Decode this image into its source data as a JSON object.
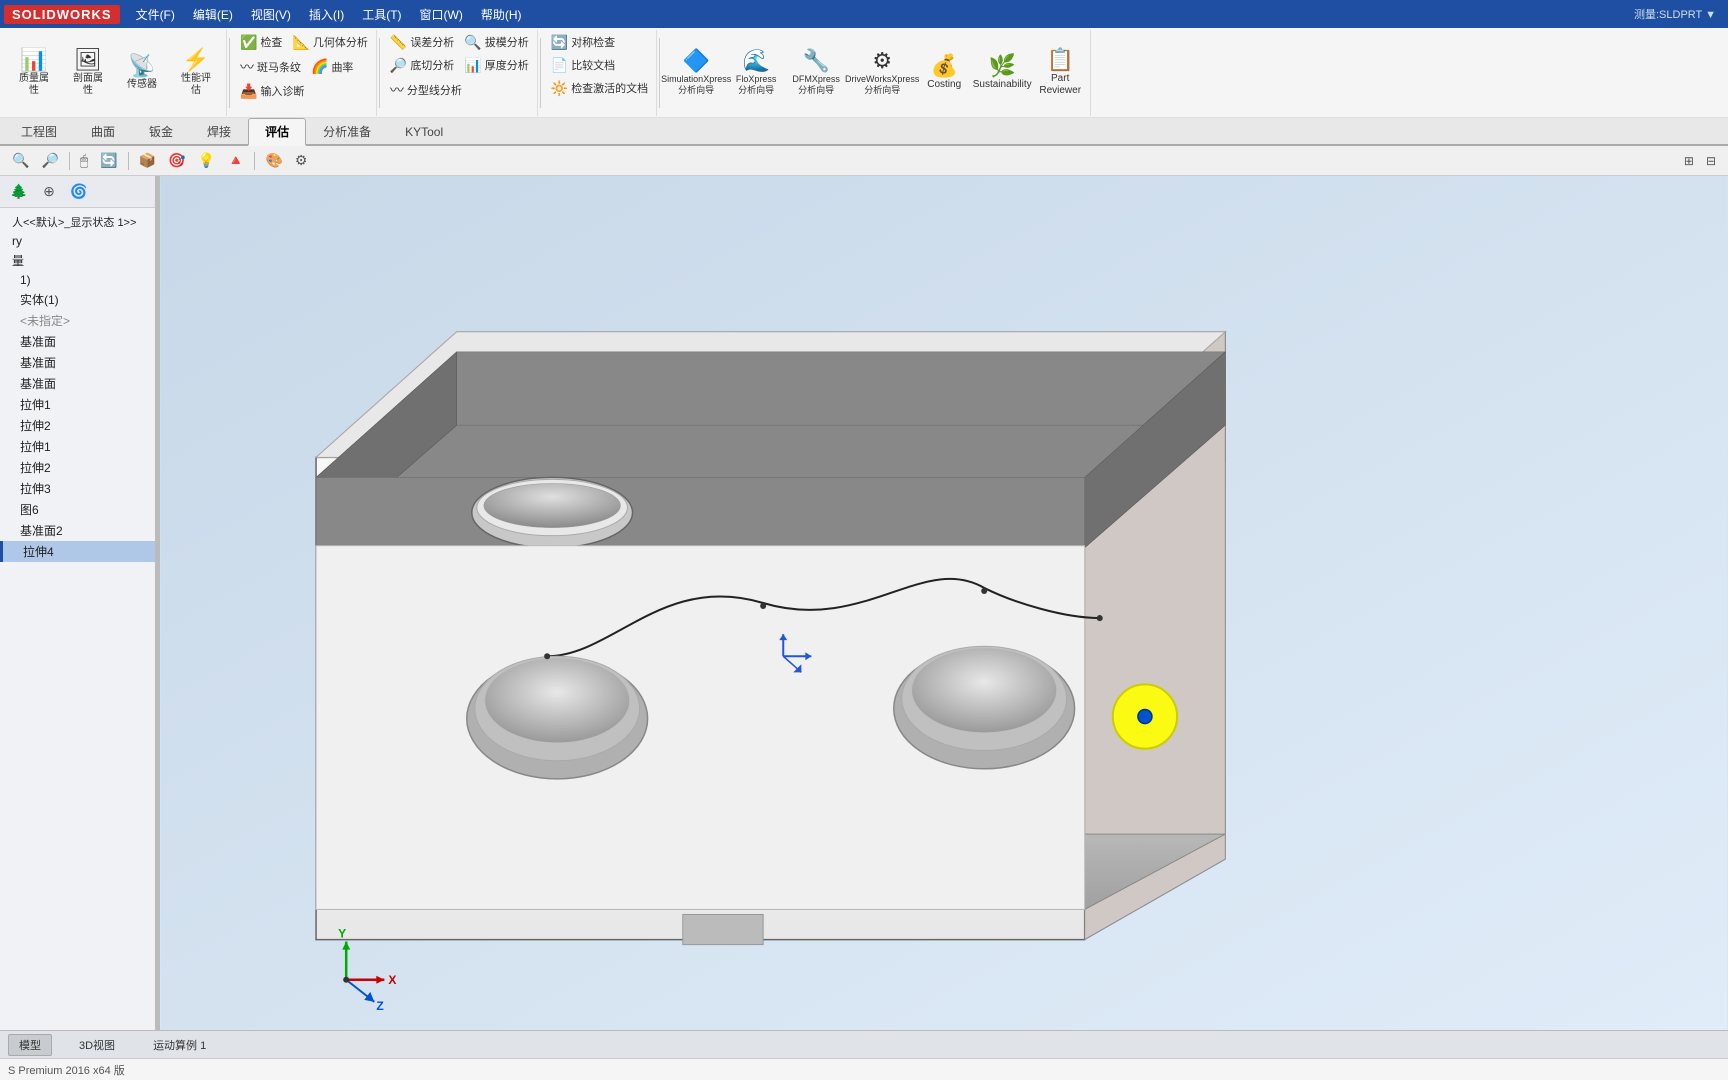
{
  "app": {
    "logo": "SOLIDWORKS",
    "title_bar_info": "测量:SLDPRT ▼",
    "menus": [
      "文件(F)",
      "编辑(E)",
      "视图(V)",
      "插入(I)",
      "工具(T)",
      "窗口(W)",
      "帮助(H)"
    ]
  },
  "toolbar": {
    "pin_icon": "📌",
    "groups": [
      {
        "name": "quality-group",
        "buttons": [
          {
            "id": "quality-check",
            "icon": "📊",
            "label": "质量属\n性"
          },
          {
            "id": "section-view",
            "icon": "📋",
            "label": "剖面属\n性"
          },
          {
            "id": "sensor",
            "icon": "📡",
            "label": "传感器"
          },
          {
            "id": "performance",
            "icon": "⚡",
            "label": "性能评\n估"
          }
        ]
      },
      {
        "name": "check-group",
        "buttons": [
          {
            "id": "check",
            "icon": "✅",
            "label": "检查"
          },
          {
            "id": "geometry-check",
            "icon": "📐",
            "label": "几何体分析"
          },
          {
            "id": "zebra-lines",
            "icon": "🦓",
            "label": "斑马条纹"
          },
          {
            "id": "curvature",
            "icon": "〰",
            "label": "曲率"
          },
          {
            "id": "input-diag",
            "icon": "📥",
            "label": "输入诊断"
          }
        ]
      },
      {
        "name": "analysis-group",
        "buttons": [
          {
            "id": "deviation-analysis",
            "icon": "📏",
            "label": "误差分析"
          },
          {
            "id": "draft-analysis",
            "icon": "🔍",
            "label": "拔模分析"
          },
          {
            "id": "undercut-analysis",
            "icon": "🔎",
            "label": "底切分析"
          },
          {
            "id": "thickness-analysis",
            "icon": "📊",
            "label": "厚度分析"
          },
          {
            "id": "parting-line-analysis",
            "icon": "〰",
            "label": "分型线分析"
          }
        ]
      },
      {
        "name": "check2-group",
        "buttons": [
          {
            "id": "symmetry-check",
            "icon": "🔄",
            "label": "对称检查"
          },
          {
            "id": "compare-doc",
            "icon": "📄",
            "label": "比较文档"
          },
          {
            "id": "check-activate",
            "icon": "🔆",
            "label": "检查激活\n的文档"
          }
        ]
      },
      {
        "name": "xpress-group",
        "buttons": [
          {
            "id": "simulation-xpress",
            "icon": "🔷",
            "label": "SimulationXpress\n分析向导"
          },
          {
            "id": "flo-xpress",
            "icon": "🌊",
            "label": "FloXpress\n分析向导"
          },
          {
            "id": "dfm-xpress",
            "icon": "🔧",
            "label": "DFMXpress\n分析向导"
          },
          {
            "id": "drive-works-xpress",
            "icon": "⚙",
            "label": "DriveWorksXpress\n分析向导"
          },
          {
            "id": "costing",
            "icon": "💰",
            "label": "Costing"
          },
          {
            "id": "sustainability",
            "icon": "🌿",
            "label": "Sustainability"
          },
          {
            "id": "part-reviewer",
            "icon": "📋",
            "label": "Part\nReviewer"
          }
        ]
      }
    ]
  },
  "tabs": [
    "工程图",
    "曲面",
    "钣金",
    "焊接",
    "评估",
    "分析准备",
    "KYTool"
  ],
  "active_tab": "评估",
  "icon_bar": {
    "icons": [
      "🔍",
      "🔎",
      "🖱",
      "📷",
      "📦",
      "🎯",
      "💡",
      "🔺",
      "📌",
      "⚙"
    ]
  },
  "left_panel": {
    "header_icons": [
      "🔤",
      "⊕",
      "🌀"
    ],
    "tree_items": [
      {
        "label": "人<<默认>_显示状态 1>>",
        "indent": 0
      },
      {
        "label": "ry",
        "indent": 0
      },
      {
        "label": "量",
        "indent": 0
      },
      {
        "label": "1)",
        "indent": 1
      },
      {
        "label": "实体(1)",
        "indent": 1
      },
      {
        "label": "<未指定>",
        "indent": 1
      },
      {
        "label": "基准面",
        "indent": 1
      },
      {
        "label": "基准面",
        "indent": 1
      },
      {
        "label": "基准面",
        "indent": 1
      },
      {
        "label": "拉伸1",
        "indent": 1
      },
      {
        "label": "拉伸2",
        "indent": 1
      },
      {
        "label": "拉伸1",
        "indent": 1
      },
      {
        "label": "拉伸2",
        "indent": 1
      },
      {
        "label": "拉伸3",
        "indent": 1
      },
      {
        "label": "图6",
        "indent": 1
      },
      {
        "label": "基准面2",
        "indent": 1
      },
      {
        "label": "拉伸4",
        "indent": 1,
        "selected": true
      }
    ]
  },
  "status_bar": {
    "tabs": [
      "模型",
      "3D视图",
      "运动算例 1"
    ]
  },
  "bottom_bar": {
    "text": "S Premium 2016 x64 版"
  },
  "viewport": {
    "background_gradient_start": "#d0dce8",
    "background_gradient_end": "#e8f0f8"
  }
}
